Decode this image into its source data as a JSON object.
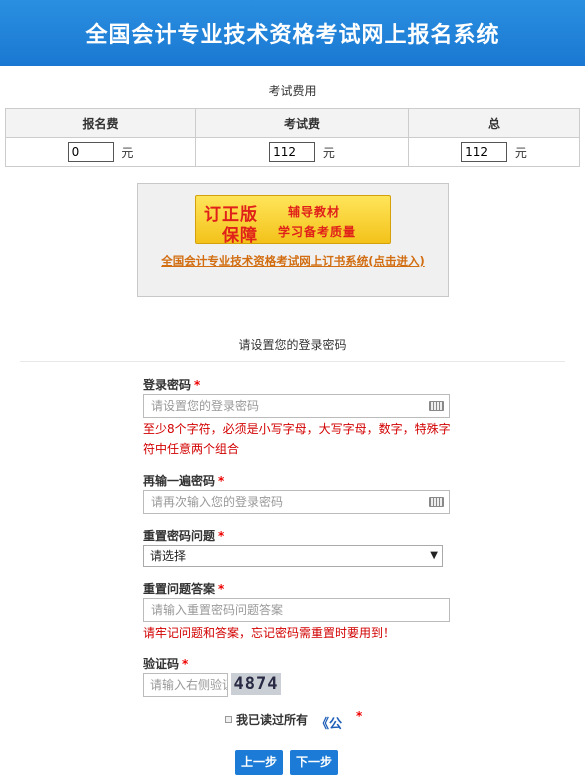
{
  "header": {
    "title": "全国会计专业技术资格考试网上报名系统"
  },
  "fee": {
    "section_title": "考试费用",
    "columns": [
      "报名费",
      "考试费",
      "总"
    ],
    "values": [
      "0",
      "112",
      "112"
    ],
    "unit": "元"
  },
  "book": {
    "banner_line1": "订正版",
    "banner_line2": "保障",
    "banner_line3": "辅导教材",
    "banner_line4": "学习备考质量",
    "link": "全国会计专业技术资格考试网上订书系统(点击进入)"
  },
  "password_section": {
    "title": "请设置您的登录密码",
    "login_password": {
      "label": "登录密码",
      "required": "*",
      "placeholder": "请设置您的登录密码",
      "hint": "至少8个字符，必须是小写字母，大写字母，数字，特殊字符中任意两个组合"
    },
    "confirm_password": {
      "label": "再输一遍密码",
      "required": "*",
      "placeholder": "请再次输入您的登录密码"
    },
    "question": {
      "label": "重置密码问题",
      "required": "*",
      "selected": "请选择"
    },
    "answer": {
      "label": "重置问题答案",
      "required": "*",
      "placeholder": "请输入重置密码问题答案",
      "hint": "请牢记问题和答案，忘记密码需重置时要用到！"
    },
    "captcha": {
      "label": "验证码",
      "required": "*",
      "placeholder": "请输入右侧验证码",
      "code": "4874"
    },
    "agree": {
      "text": "我已读过所有",
      "link": "《公",
      "required": "*"
    }
  },
  "buttons": {
    "prev": "上一步",
    "next": "下一步"
  }
}
